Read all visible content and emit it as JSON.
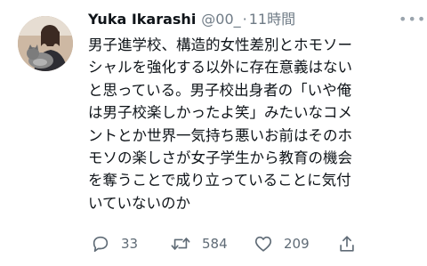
{
  "tweet": {
    "author": {
      "display_name": "Yuka Ikarashi",
      "handle": "@00_",
      "separator": "·",
      "time": "11時間"
    },
    "menu_icon": "more-dots-icon",
    "text_lines": [
      "男子進学校、構造的女性差別とホモソー",
      "シャルを強化する以外に存在意義はない",
      "と思っている。男子校出身者の「いや俺",
      "は男子校楽しかったよ笑」みたいなコメ",
      "ントとか世界一気持ち悪いお前はそのホ",
      "モソの楽しさが女子学生から教育の機会",
      "を奪うことで成り立っていることに気付",
      "いていないのか"
    ],
    "actions": {
      "reply": {
        "icon": "reply-icon",
        "count": "33"
      },
      "retweet": {
        "icon": "retweet-icon",
        "count": "584"
      },
      "like": {
        "icon": "heart-icon",
        "count": "209"
      },
      "share": {
        "icon": "share-icon"
      }
    },
    "colors": {
      "text": "#0f1419",
      "secondary": "#6f7b86",
      "icon": "#5f6b76",
      "background": "#ffffff"
    }
  }
}
